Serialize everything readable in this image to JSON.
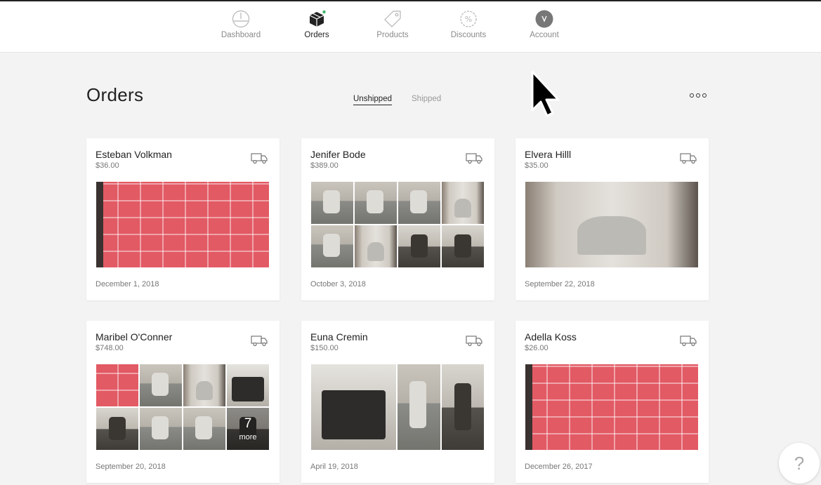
{
  "nav": {
    "items": [
      {
        "label": "Dashboard",
        "icon": "dashboard-icon"
      },
      {
        "label": "Orders",
        "icon": "box-icon",
        "active": true
      },
      {
        "label": "Products",
        "icon": "tag-icon"
      },
      {
        "label": "Discounts",
        "icon": "percent-icon"
      },
      {
        "label": "Account",
        "icon": "account-icon"
      }
    ]
  },
  "page": {
    "title": "Orders",
    "more_icon": "more-icon"
  },
  "tabs": [
    {
      "label": "Unshipped",
      "active": true
    },
    {
      "label": "Shipped",
      "active": false
    }
  ],
  "orders": [
    {
      "name": "Esteban Volkman",
      "price": "$36.00",
      "date": "December 1, 2018"
    },
    {
      "name": "Jenifer Bode",
      "price": "$389.00",
      "date": "October 3, 2018"
    },
    {
      "name": "Elvera Hilll",
      "price": "$35.00",
      "date": "September 22, 2018"
    },
    {
      "name": "Maribel O'Conner",
      "price": "$748.00",
      "date": "September 20, 2018",
      "more_count": "7",
      "more_label": "more"
    },
    {
      "name": "Euna Cremin",
      "price": "$150.00",
      "date": "April 19, 2018"
    },
    {
      "name": "Adella Koss",
      "price": "$26.00",
      "date": "December 26, 2017"
    }
  ],
  "help": {
    "label": "?"
  },
  "colors": {
    "accent_dot": "#3fb56b",
    "background": "#f3f3f3",
    "text": "#222222",
    "muted": "#777777"
  }
}
